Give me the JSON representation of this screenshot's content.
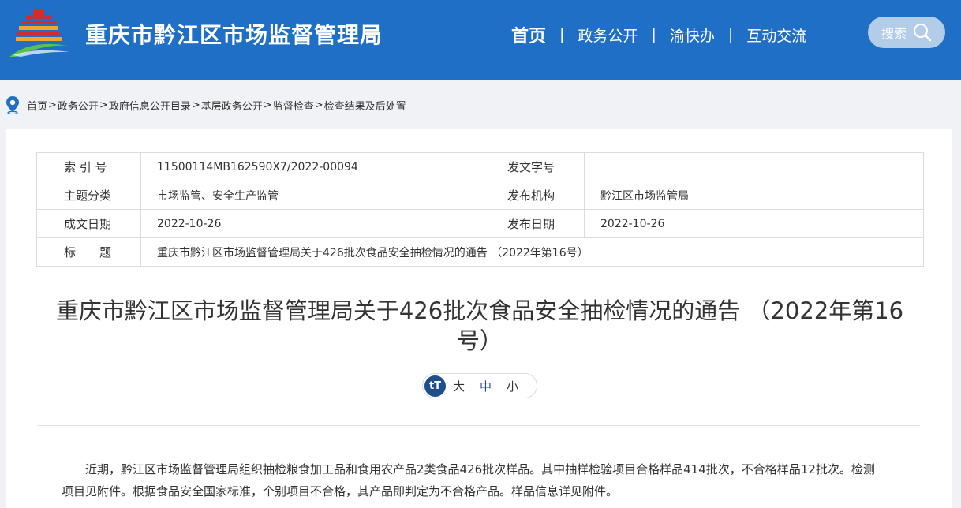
{
  "header": {
    "site_title": "重庆市黔江区市场监督管理局",
    "nav": [
      "首页",
      "政务公开",
      "渝快办",
      "互动交流"
    ],
    "nav_sep": "|",
    "search_label": "搜索"
  },
  "breadcrumb": {
    "items": [
      "首页",
      "政务公开",
      "政府信息公开目录",
      "基层政务公开",
      "监督检查",
      "检查结果及后处置"
    ],
    "sep": ">"
  },
  "meta": {
    "index_label": "索 引 号",
    "index_value": "11500114MB162590X7/2022-00094",
    "docno_label": "发文字号",
    "docno_value": "",
    "topic_label": "主题分类",
    "topic_value": "市场监管、安全生产监管",
    "publisher_label": "发布机构",
    "publisher_value": "黔江区市场监管局",
    "created_label": "成文日期",
    "created_value": "2022-10-26",
    "published_label": "发布日期",
    "published_value": "2022-10-26",
    "title_label": "标　　题",
    "title_value": "重庆市黔江区市场监督管理局关于426批次食品安全抽检情况的通告 （2022年第16号）"
  },
  "article": {
    "title": "重庆市黔江区市场监督管理局关于426批次食品安全抽检情况的通告 （2022年第16号）",
    "font_size": {
      "icon": "tT",
      "large": "大",
      "medium": "中",
      "small": "小"
    },
    "paragraph": "近期，黔江区市场监督管理局组织抽检粮食加工品和食用农产品2类食品426批次样品。其中抽样检验项目合格样品414批次，不合格样品12批次。检测项目见附件。根据食品安全国家标准，个别项目不合格，其产品即判定为不合格产品。样品信息详见附件。"
  },
  "colors": {
    "header_bg": "#1f6fc7",
    "accent_dark": "#1f4e8c"
  }
}
